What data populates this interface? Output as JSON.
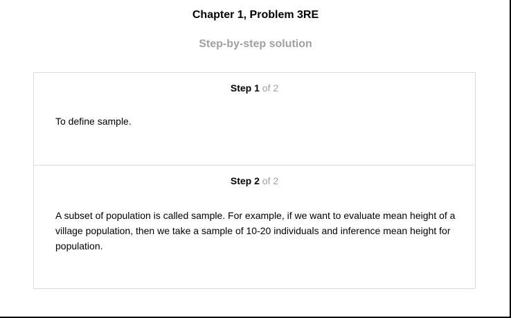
{
  "page": {
    "chapter_title": "Chapter 1, Problem 3RE",
    "solution_heading": "Step-by-step solution"
  },
  "steps": [
    {
      "label": "Step",
      "number": "1",
      "total": "of 2",
      "text": "To define sample."
    },
    {
      "label": "Step",
      "number": "2",
      "total": "of 2",
      "text": "A subset of population is called sample. For example, if we want to evaluate mean height of a village population, then we take a sample of 10-20 individuals and inference mean height for population."
    }
  ],
  "colors": {
    "text": "#000000",
    "muted": "#a0a0a0",
    "border": "#dcdcdc",
    "frame": "#000000"
  }
}
